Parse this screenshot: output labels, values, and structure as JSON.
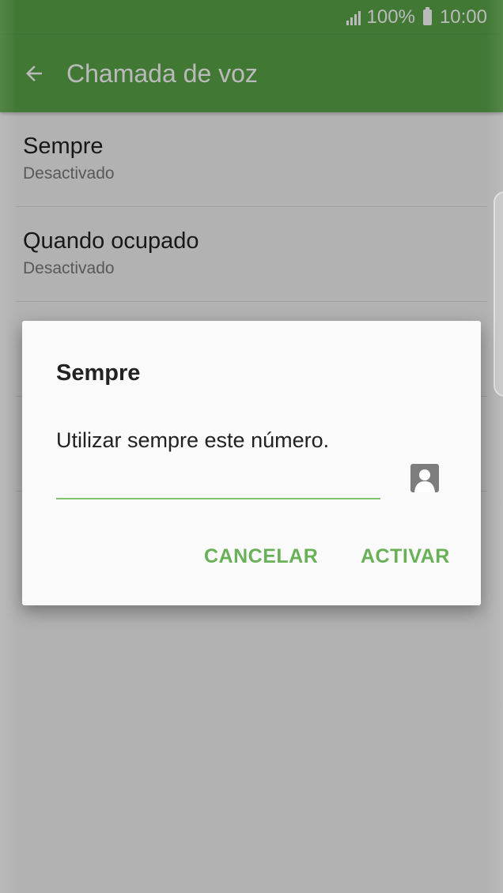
{
  "status_bar": {
    "battery": "100%",
    "time": "10:00"
  },
  "app_bar": {
    "title": "Chamada de voz"
  },
  "list": {
    "items": [
      {
        "title": "Sempre",
        "subtitle": "Desactivado"
      },
      {
        "title": "Quando ocupado",
        "subtitle": "Desactivado"
      }
    ]
  },
  "dialog": {
    "title": "Sempre",
    "message": "Utilizar sempre este número.",
    "number_value": "",
    "cancel_label": "CANCELAR",
    "activate_label": "ACTIVAR"
  },
  "colors": {
    "primary": "#5aa548",
    "accent": "#6ab058",
    "underline": "#7bc46a"
  }
}
